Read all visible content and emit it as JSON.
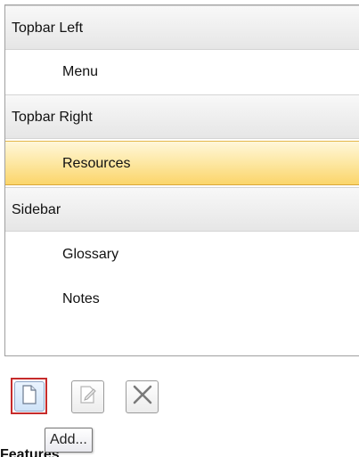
{
  "list": {
    "groups": [
      {
        "label": "Topbar Left",
        "items": [
          {
            "label": "Menu",
            "selected": false
          }
        ]
      },
      {
        "label": "Topbar Right",
        "items": [
          {
            "label": "Resources",
            "selected": true
          }
        ]
      },
      {
        "label": "Sidebar",
        "items": [
          {
            "label": "Glossary",
            "selected": false
          },
          {
            "label": "Notes",
            "selected": false
          }
        ]
      }
    ]
  },
  "toolbar": {
    "add_icon": "new-page-icon",
    "edit_icon": "edit-page-icon",
    "delete_icon": "delete-x-icon",
    "tooltip": "Add..."
  },
  "colors": {
    "selection": "#fbd56a",
    "highlight_box": "#c62b2b",
    "group_header": "#e6e6e6"
  },
  "footer": {
    "clipped_label": "Features"
  }
}
